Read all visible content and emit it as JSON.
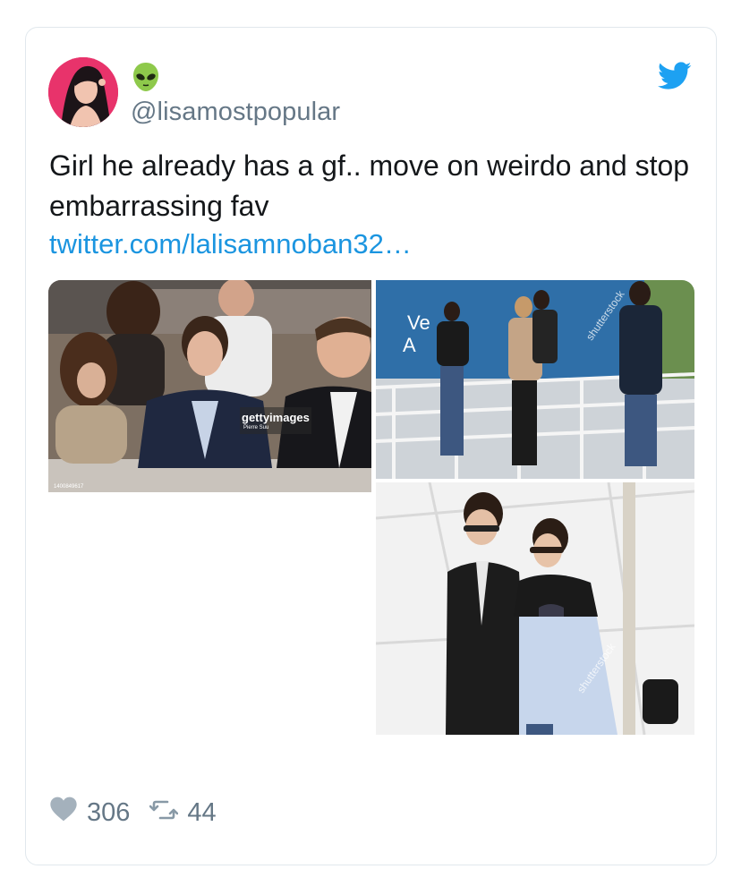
{
  "tweet": {
    "display_name_icon": "alien-emoji",
    "handle": "@lisamostpopular",
    "text": "Girl he already has a gf.. move on weirdo and stop embarrassing fav",
    "link": "twitter.com/lalisamnoban32…",
    "likes": "306",
    "retweets": "44"
  },
  "media": {
    "photo1": {
      "watermark": "gettyimages",
      "credit": "Pierre Suu",
      "photo_id": "1400849617"
    },
    "photo2": {
      "watermark": "shutterstock"
    },
    "photo3": {
      "watermark": "shutterstock"
    }
  },
  "colors": {
    "twitter_blue": "#1da1f2",
    "link": "#1b95e0",
    "muted": "#657786",
    "border": "#e1e8ed"
  }
}
